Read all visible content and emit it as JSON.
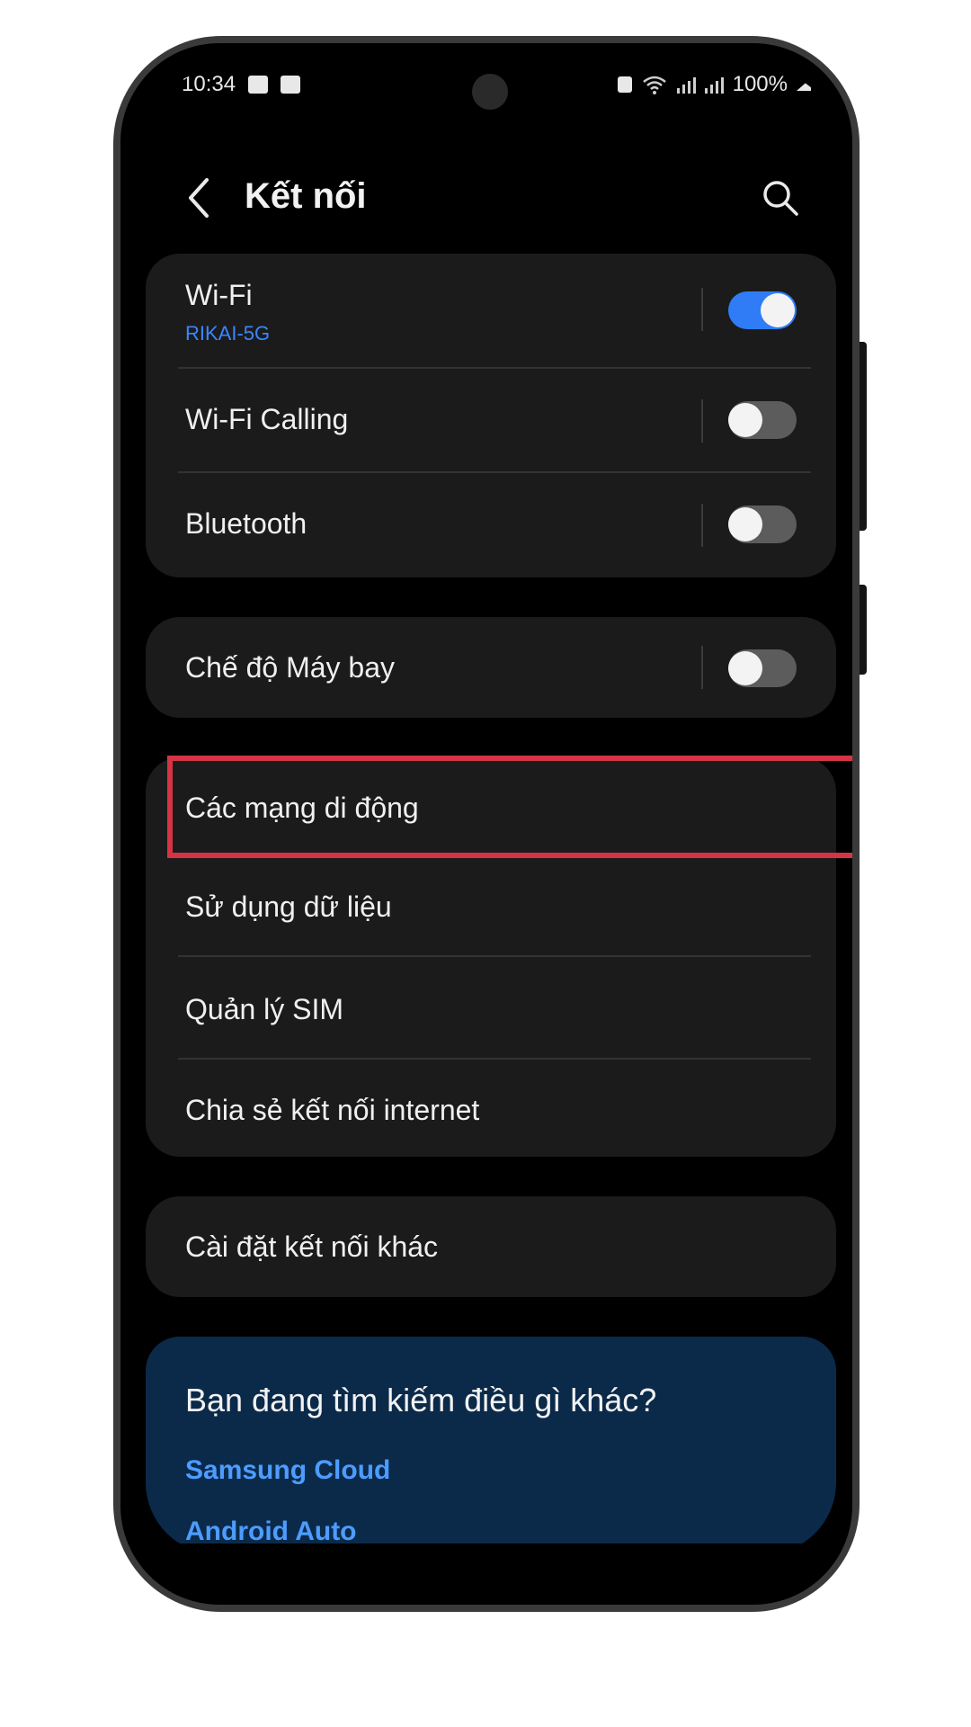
{
  "status_bar": {
    "time": "10:34",
    "battery": "100%"
  },
  "header": {
    "title": "Kết nối"
  },
  "group1": {
    "wifi": {
      "label": "Wi-Fi",
      "network": "RIKAI-5G",
      "enabled": true
    },
    "wifi_calling": {
      "label": "Wi-Fi Calling",
      "enabled": false
    },
    "bluetooth": {
      "label": "Bluetooth",
      "enabled": false
    }
  },
  "group2": {
    "airplane": {
      "label": "Chế độ Máy bay",
      "enabled": false
    }
  },
  "group3": {
    "items": [
      {
        "label": "Các mạng di động"
      },
      {
        "label": "Sử dụng dữ liệu"
      },
      {
        "label": "Quản lý SIM"
      },
      {
        "label": "Chia sẻ kết nối internet"
      }
    ]
  },
  "group4": {
    "label": "Cài đặt kết nối khác"
  },
  "suggestions": {
    "question": "Bạn đang tìm kiếm điều gì khác?",
    "links": [
      "Samsung Cloud",
      "Android Auto"
    ]
  },
  "colors": {
    "accent": "#2f7cf6",
    "highlight": "#d63445",
    "link": "#4d9cff"
  }
}
